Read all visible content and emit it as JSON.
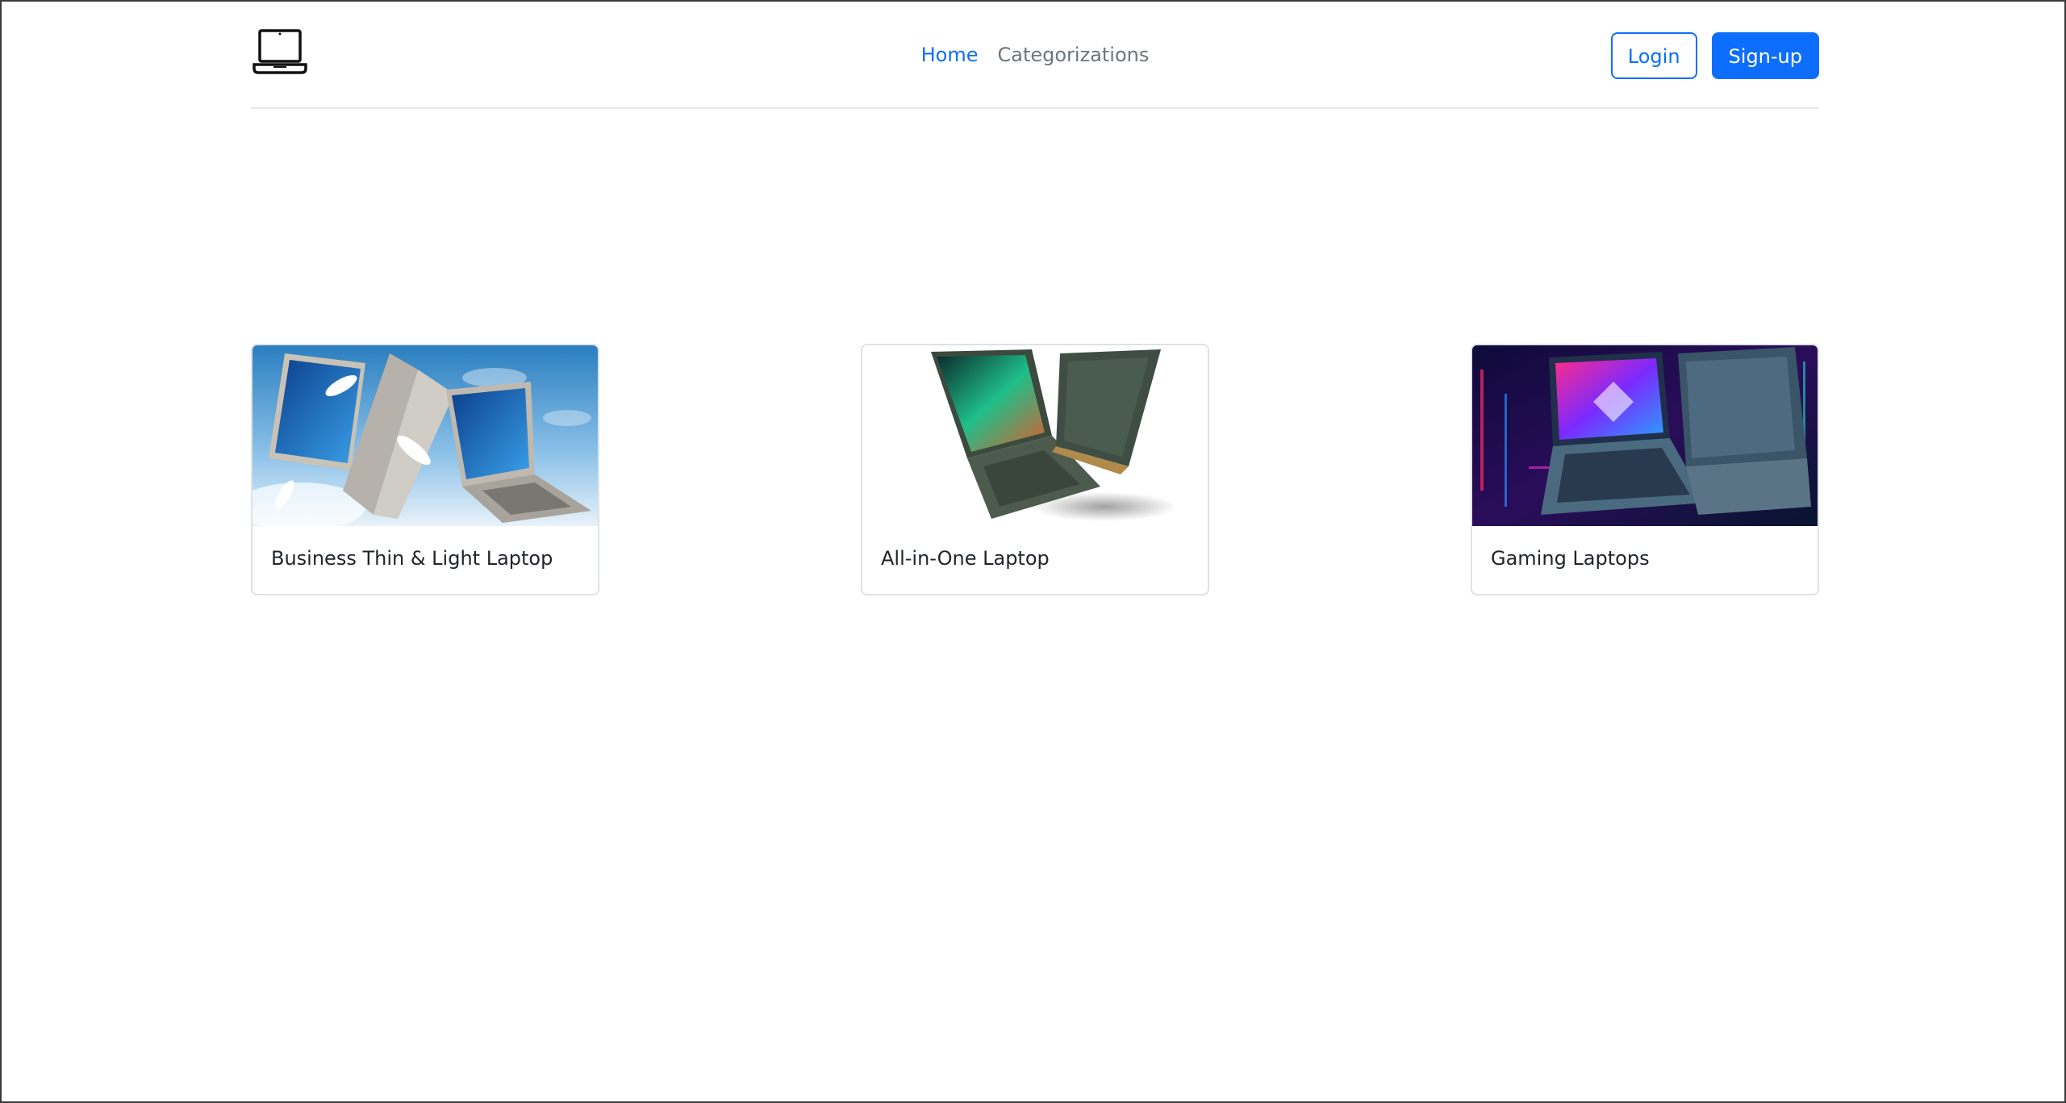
{
  "header": {
    "logo_icon": "laptop-icon",
    "nav": [
      {
        "label": "Home",
        "active": true
      },
      {
        "label": "Categorizations",
        "active": false
      }
    ],
    "login_label": "Login",
    "signup_label": "Sign-up"
  },
  "categories": [
    {
      "title": "Business Thin & Light Laptop"
    },
    {
      "title": "All-in-One Laptop"
    },
    {
      "title": "Gaming Laptops"
    }
  ],
  "colors": {
    "primary": "#0d6efd",
    "muted_nav": "#6c757d",
    "border": "#dee2e6"
  }
}
